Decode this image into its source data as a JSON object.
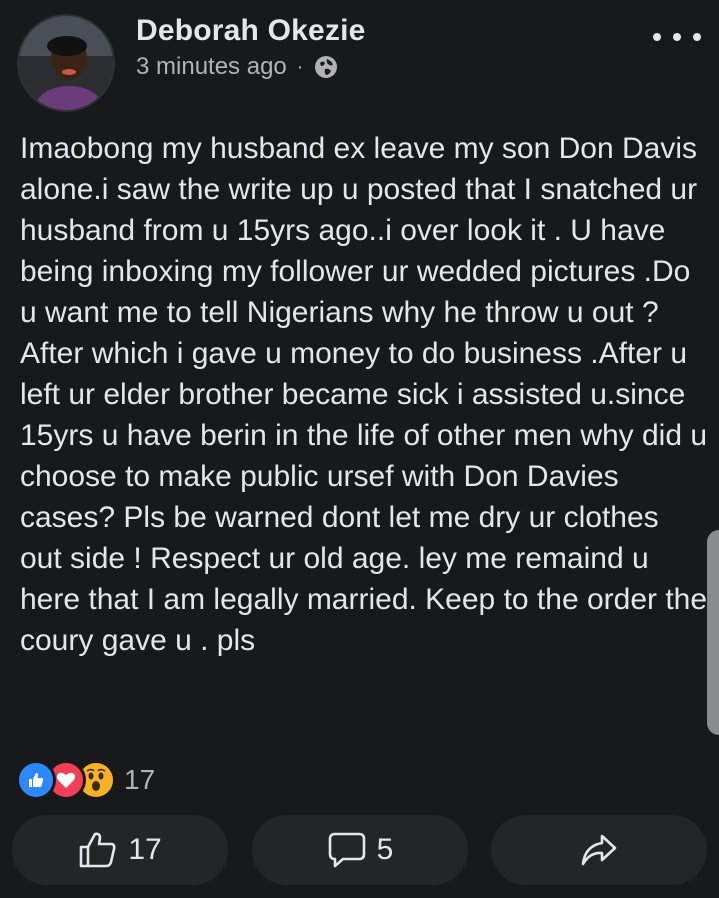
{
  "post": {
    "author": "Deborah Okezie",
    "timestamp": "3 minutes ago",
    "separator": "·",
    "audience_icon": "globe-icon",
    "text": "Imaobong my husband ex leave my son Don Davis alone.i saw the write up u posted that I snatched ur husband from u 15yrs ago..i over look it . U have being inboxing my follower ur wedded pictures .Do u want me to tell Nigerians why he throw u out ? After which i gave u money to do business .After u left ur elder brother became sick i assisted u.since 15yrs u have berin in the life of other men why did u choose to make public ursef with Don Davies cases? Pls be warned dont let me dry ur clothes out side ! Respect ur old age. ley me remaind u here that I am legally married. Keep to the order the coury gave u . pls"
  },
  "reactions": {
    "icons": [
      "like-icon",
      "love-icon",
      "wow-icon"
    ],
    "count": "17"
  },
  "actions": {
    "like_count": "17",
    "comment_count": "5"
  },
  "colors": {
    "background": "#18191a",
    "button_bg": "#242526",
    "text_primary": "#e4e6eb",
    "text_secondary": "#b0b3b8",
    "like_blue": "#2d88ff",
    "love_red": "#f33e58",
    "wow_yellow": "#f7b125"
  }
}
